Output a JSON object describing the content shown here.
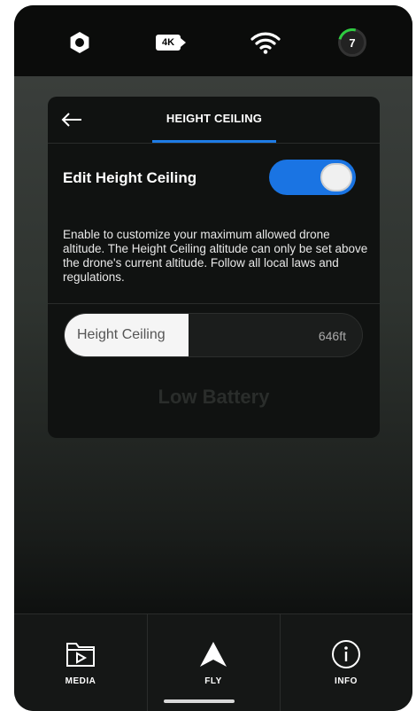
{
  "status_bar": {
    "icons": [
      "gear-icon",
      "4k-camera-icon",
      "wifi-icon",
      "satellite-count-badge"
    ],
    "camera_label": "4K",
    "badge_count": "7",
    "badge_accent": "#2ecc40"
  },
  "panel": {
    "back_icon": "arrow-left-icon",
    "tab_title": "HEIGHT CEILING",
    "toggle": {
      "label": "Edit Height Ceiling",
      "state": "on",
      "color": "#1a74e3"
    },
    "description": "Enable to customize your maximum allowed drone altitude. The Height Ceiling altitude can only be set above the drone's current altitude. Follow all local laws and regulations.",
    "height_ceiling": {
      "label": "Height Ceiling",
      "value": "646ft"
    }
  },
  "background": {
    "alert_title": "Low Battery"
  },
  "bottom_nav": {
    "items": [
      {
        "label": "MEDIA",
        "icon": "media-folder-icon"
      },
      {
        "label": "FLY",
        "icon": "fly-arrow-icon"
      },
      {
        "label": "INFO",
        "icon": "info-icon"
      }
    ],
    "active": "FLY"
  }
}
